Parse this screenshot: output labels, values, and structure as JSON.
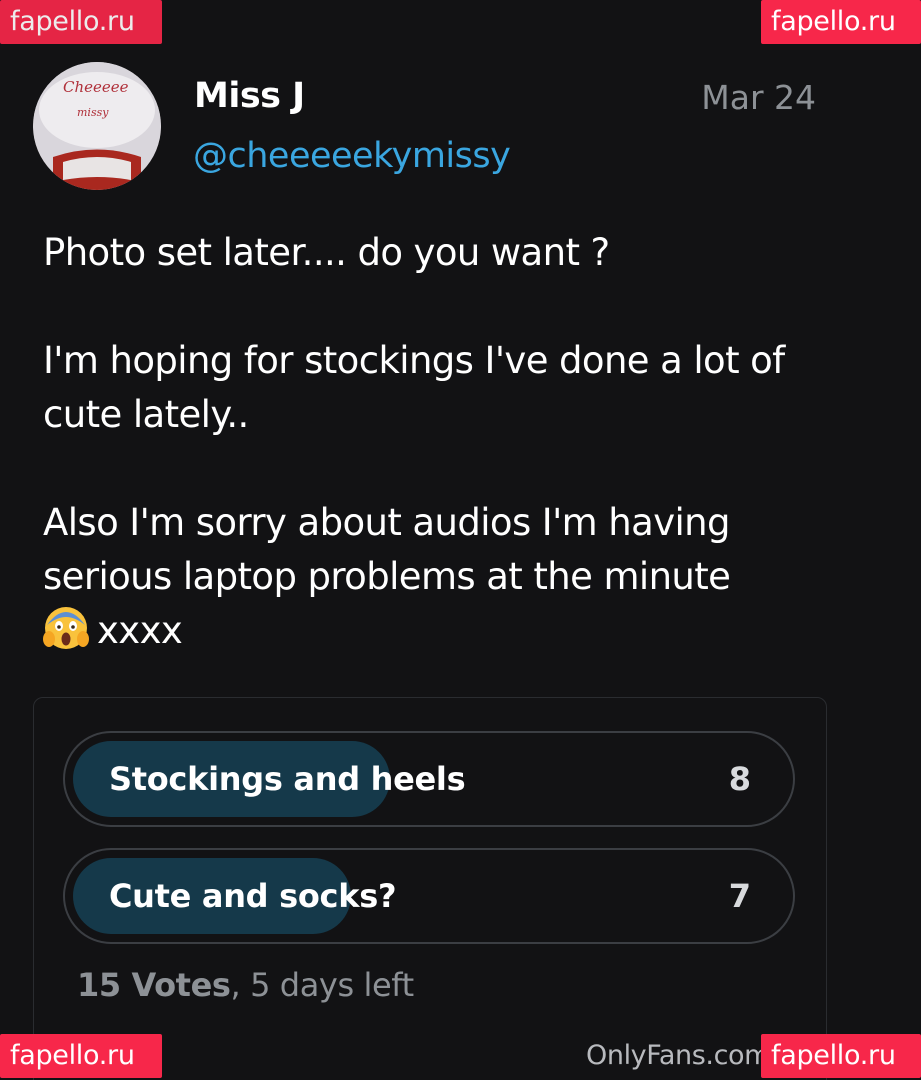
{
  "watermarks": {
    "top_left": "fapello.ru",
    "top_right": "fapello.ru",
    "bottom_left": "fapello.ru",
    "bottom_right": "fapello.ru"
  },
  "post": {
    "author_name": "Miss J",
    "author_handle": "@cheeeeekymissy",
    "date": "Mar 24",
    "avatar_text_line1": "Cheeeee",
    "avatar_text_line2": "missy",
    "paragraphs": [
      "Photo set later.... do you want ?",
      "I'm hoping for stockings I've done a lot of cute lately..",
      "Also I'm sorry about audios I'm having serious laptop problems at the minute"
    ],
    "last_line_emoji": "face-screaming-in-fear-icon",
    "last_line_text": "xxxx"
  },
  "poll": {
    "options": [
      {
        "label": "Stockings and heels",
        "count": "8",
        "share": 0.533
      },
      {
        "label": "Cute and socks?",
        "count": "7",
        "share": 0.467
      }
    ],
    "votes_text": "15 Votes",
    "time_left_text": ", 5 days left"
  },
  "footer": {
    "source_text": "OnlyFans.com"
  },
  "colors": {
    "background": "#121214",
    "watermark": "#f7274a",
    "handle": "#3aa6e0",
    "poll_fill": "#15394a",
    "muted_text": "#8d9196"
  }
}
